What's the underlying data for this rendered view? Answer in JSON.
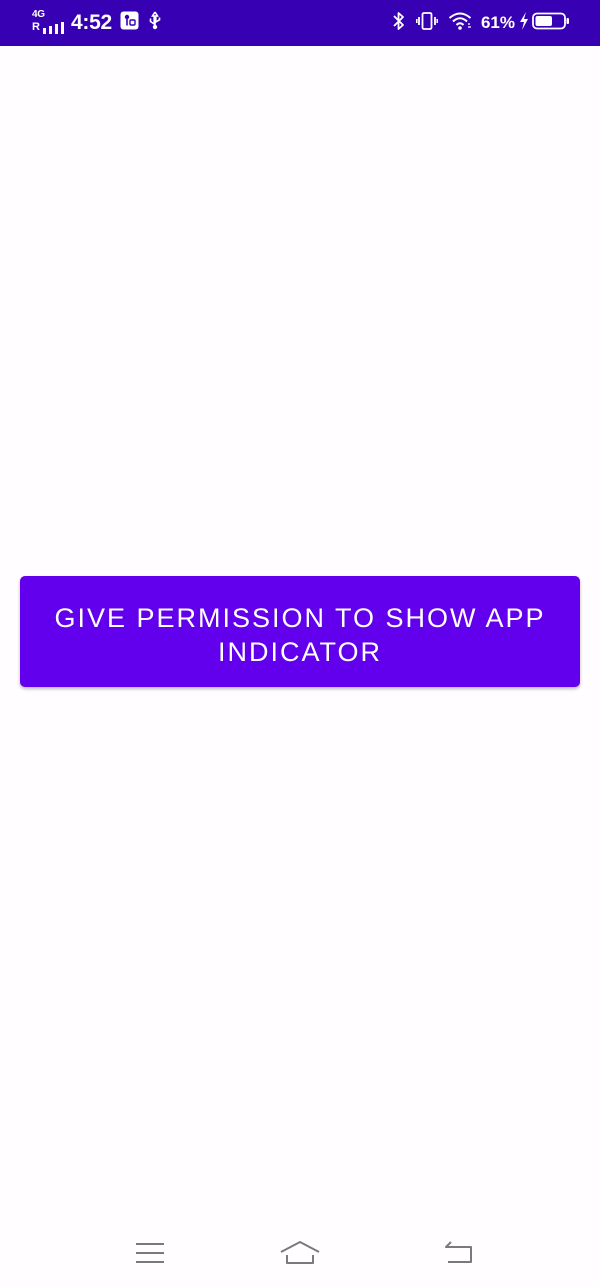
{
  "status_bar": {
    "network_type": "4G",
    "roaming": "R",
    "time": "4:52",
    "battery_percent": "61%",
    "icons": {
      "signal": "signal-bars-icon",
      "notification": "vpn-key-notification-icon",
      "usb": "usb-icon",
      "bluetooth": "bluetooth-icon",
      "vibrate": "vibrate-icon",
      "wifi": "wifi-icon",
      "charging": "charging-bolt-icon",
      "battery": "battery-icon"
    },
    "battery_level": 0.61
  },
  "main": {
    "permission_button_label": "GIVE PERMISSION TO SHOW APP INDICATOR"
  },
  "nav_bar": {
    "icons": {
      "menu": "menu-lines-icon",
      "home": "home-icon",
      "back": "back-icon"
    }
  },
  "colors": {
    "status_bar": "#3700b3",
    "primary": "#6200ee",
    "background": "#fffdff",
    "on_primary": "#ffffff",
    "nav_icon": "#7a7a7a"
  }
}
